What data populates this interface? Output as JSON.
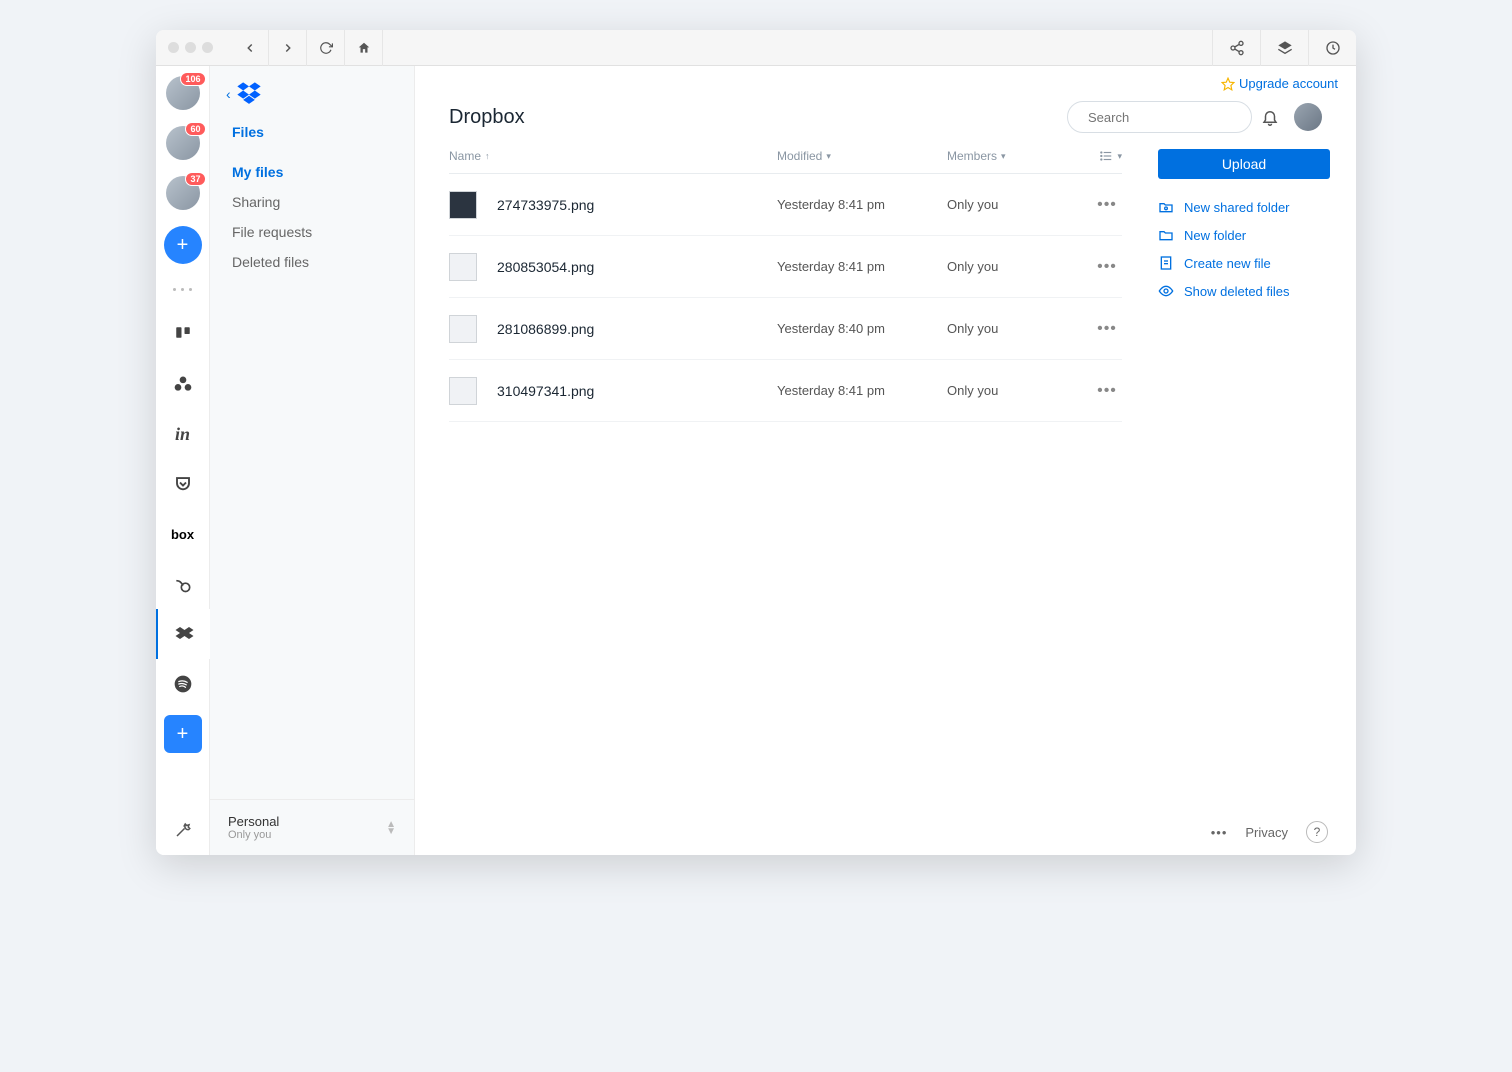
{
  "rail": {
    "avatars": [
      {
        "badge": "106"
      },
      {
        "badge": "60"
      },
      {
        "badge": "37"
      }
    ],
    "apps": [
      {
        "name": "trello-icon"
      },
      {
        "name": "asana-icon"
      },
      {
        "name": "invision-icon"
      },
      {
        "name": "pocket-icon"
      },
      {
        "name": "box-icon"
      },
      {
        "name": "bonsai-icon"
      },
      {
        "name": "dropbox-icon"
      },
      {
        "name": "spotify-icon"
      }
    ]
  },
  "sidebar": {
    "section": "Files",
    "items": [
      "My files",
      "Sharing",
      "File requests",
      "Deleted files"
    ],
    "footer": {
      "label": "Personal",
      "sub": "Only you"
    }
  },
  "upgrade_label": "Upgrade account",
  "page_title": "Dropbox",
  "search_placeholder": "Search",
  "columns": {
    "name": "Name",
    "modified": "Modified",
    "members": "Members"
  },
  "files": [
    {
      "name": "274733975.png",
      "modified": "Yesterday 8:41 pm",
      "members": "Only you",
      "thumb": "dark"
    },
    {
      "name": "280853054.png",
      "modified": "Yesterday 8:41 pm",
      "members": "Only you",
      "thumb": "light"
    },
    {
      "name": "281086899.png",
      "modified": "Yesterday 8:40 pm",
      "members": "Only you",
      "thumb": "light"
    },
    {
      "name": "310497341.png",
      "modified": "Yesterday 8:41 pm",
      "members": "Only you",
      "thumb": "light"
    }
  ],
  "actions": {
    "upload": "Upload",
    "links": [
      "New shared folder",
      "New folder",
      "Create new file",
      "Show deleted files"
    ]
  },
  "footer": {
    "privacy": "Privacy"
  }
}
